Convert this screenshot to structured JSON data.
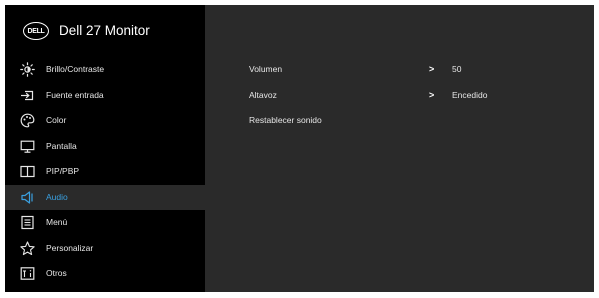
{
  "header": {
    "brand_logo": "DELL",
    "model": "Dell 27 Monitor"
  },
  "menu": [
    {
      "label": "Brillo/Contraste",
      "icon": "brightness-icon"
    },
    {
      "label": "Fuente entrada",
      "icon": "input-source-icon"
    },
    {
      "label": "Color",
      "icon": "color-palette-icon"
    },
    {
      "label": "Pantalla",
      "icon": "display-icon"
    },
    {
      "label": "PIP/PBP",
      "icon": "pip-pbp-icon"
    },
    {
      "label": "Audio",
      "icon": "speaker-icon",
      "selected": true
    },
    {
      "label": "Menú",
      "icon": "menu-icon"
    },
    {
      "label": "Personalizar",
      "icon": "star-icon"
    },
    {
      "label": "Otros",
      "icon": "others-icon"
    }
  ],
  "audio": {
    "rows": [
      {
        "label": "Volumen",
        "value": "50"
      },
      {
        "label": "Altavoz",
        "value": "Encedido"
      },
      {
        "label": "Restablecer sonido"
      }
    ]
  },
  "colors": {
    "panel_bg": "#2a2a2a",
    "sidebar_bg": "#000000",
    "accent": "#3aa0e0",
    "text": "#e6e6e6"
  }
}
